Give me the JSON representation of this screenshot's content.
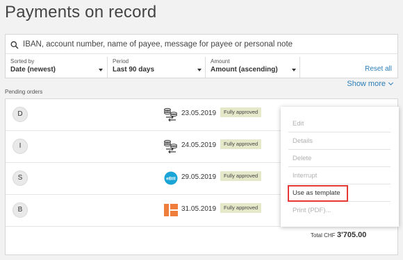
{
  "page": {
    "title": "Payments on record"
  },
  "search": {
    "placeholder": "IBAN, account number, name of payee, message for payee or personal note"
  },
  "filters": [
    {
      "label": "Sorted by",
      "value": "Date (newest)"
    },
    {
      "label": "Period",
      "value": "Last 90 days"
    },
    {
      "label": "Amount",
      "value": "Amount (ascending)"
    }
  ],
  "reset_label": "Reset all",
  "show_more_label": "Show more",
  "section_label": "Pending orders",
  "orders": [
    {
      "initial": "D",
      "icon": "transfer-coins-icon",
      "date": "23.05.2019",
      "status": "Fully approved"
    },
    {
      "initial": "I",
      "icon": "transfer-coins-icon",
      "date": "24.05.2019",
      "status": "Fully approved"
    },
    {
      "initial": "S",
      "icon": "ebill-icon",
      "icon_text": "eBill",
      "date": "29.05.2019",
      "status": "Fully approved"
    },
    {
      "initial": "B",
      "icon": "payment-slip-icon",
      "date": "31.05.2019",
      "status": "Fully approved"
    }
  ],
  "total": {
    "label": "Total CHF",
    "value": "3'705.00"
  },
  "context_menu": {
    "items": [
      {
        "label": "Edit",
        "enabled": false
      },
      {
        "label": "Details",
        "enabled": false
      },
      {
        "label": "Delete",
        "enabled": false
      },
      {
        "label": "Interrupt",
        "enabled": false
      },
      {
        "label": "Use as template",
        "enabled": true,
        "highlighted": true
      },
      {
        "label": "Print (PDF)...",
        "enabled": false
      }
    ]
  },
  "colors": {
    "link": "#2a7db8",
    "badge_bg": "#e6e9c9",
    "highlight": "#e53935",
    "ebill": "#1aa5d6",
    "payment_slip": "#ef7d3c"
  }
}
